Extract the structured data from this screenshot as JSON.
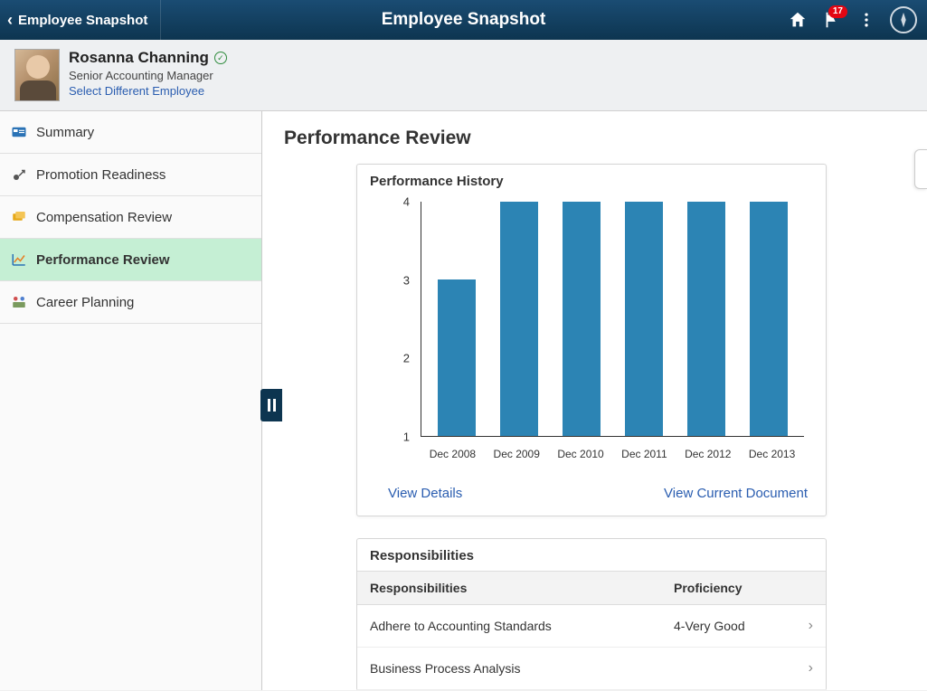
{
  "header": {
    "back_label": "Employee Snapshot",
    "title": "Employee Snapshot",
    "notification_count": "17"
  },
  "employee": {
    "name": "Rosanna Channing",
    "title": "Senior Accounting Manager",
    "select_link": "Select Different Employee"
  },
  "sidebar": {
    "items": [
      {
        "label": "Summary"
      },
      {
        "label": "Promotion Readiness"
      },
      {
        "label": "Compensation Review"
      },
      {
        "label": "Performance Review"
      },
      {
        "label": "Career Planning"
      }
    ]
  },
  "page": {
    "title": "Performance Review"
  },
  "perf_history": {
    "title": "Performance History",
    "view_details": "View Details",
    "view_current": "View Current Document"
  },
  "responsibilities": {
    "title": "Responsibilities",
    "col_resp": "Responsibilities",
    "col_prof": "Proficiency",
    "rows": [
      {
        "name": "Adhere to Accounting Standards",
        "prof": "4-Very Good"
      },
      {
        "name": "Business Process Analysis",
        "prof": ""
      }
    ]
  },
  "chart_data": {
    "type": "bar",
    "title": "Performance History",
    "categories": [
      "Dec 2008",
      "Dec 2009",
      "Dec 2010",
      "Dec 2011",
      "Dec 2012",
      "Dec 2013"
    ],
    "values": [
      3,
      4,
      4,
      4,
      4,
      4
    ],
    "ylim": [
      1,
      4
    ],
    "ylabel": "",
    "xlabel": ""
  }
}
